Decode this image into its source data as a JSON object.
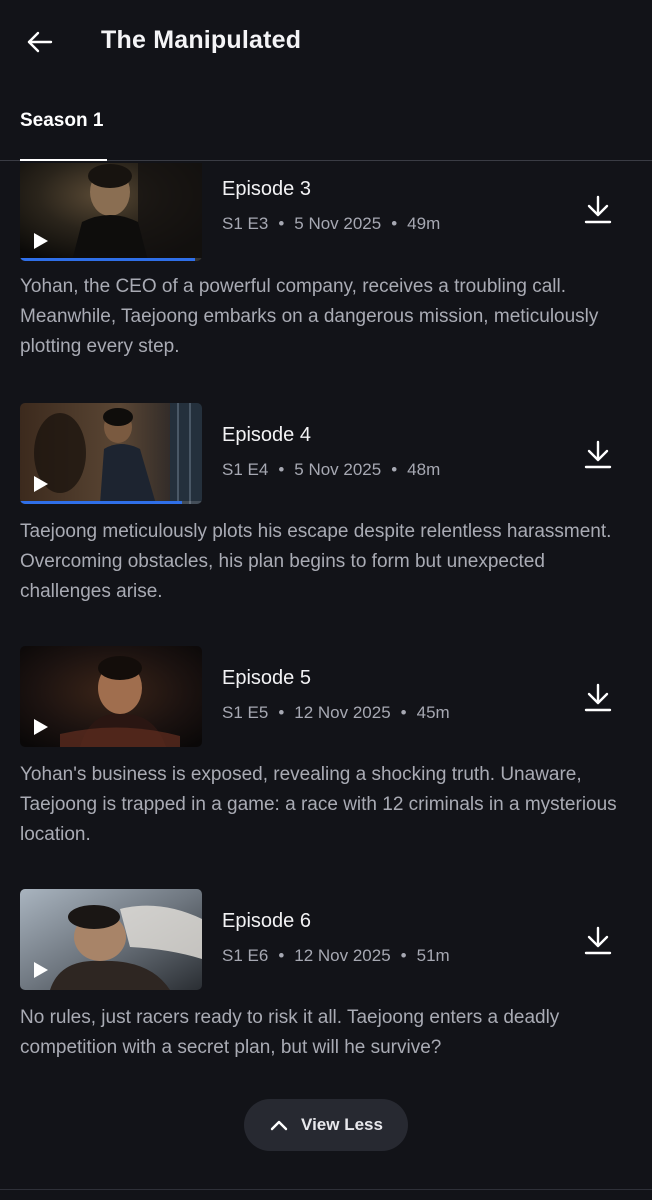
{
  "header": {
    "title": "The Manipulated"
  },
  "tabs": [
    {
      "label": "Season 1",
      "active": true
    }
  ],
  "episodes": [
    {
      "title": "Episode 3",
      "code": "S1 E3",
      "date": "5 Nov 2025",
      "duration": "49m",
      "description": "Yohan, the CEO of a powerful company, receives a troubling call. Meanwhile, Taejoong embarks on a dangerous mission, meticulously plotting every step.",
      "watch_progress": 0.96,
      "icons": {
        "play": "play-icon",
        "download": "download-icon"
      }
    },
    {
      "title": "Episode 4",
      "code": "S1 E4",
      "date": "5 Nov 2025",
      "duration": "48m",
      "description": "Taejoong meticulously plots his escape despite relentless harassment. Overcoming obstacles, his plan begins to form but unexpected challenges arise.",
      "watch_progress": 0.89,
      "icons": {
        "play": "play-icon",
        "download": "download-icon"
      }
    },
    {
      "title": "Episode 5",
      "code": "S1 E5",
      "date": "12 Nov 2025",
      "duration": "45m",
      "description": "Yohan's business is exposed, revealing a shocking truth. Unaware, Taejoong is trapped in a game: a race with 12 criminals in a mysterious location.",
      "watch_progress": 0,
      "icons": {
        "play": "play-icon",
        "download": "download-icon"
      }
    },
    {
      "title": "Episode 6",
      "code": "S1 E6",
      "date": "12 Nov 2025",
      "duration": "51m",
      "description": "No rules, just racers ready to risk it all. Taejoong enters a deadly competition with a secret plan, but will he survive?",
      "watch_progress": 0,
      "icons": {
        "play": "play-icon",
        "download": "download-icon"
      }
    }
  ],
  "view_less": {
    "label": "View Less",
    "icon": "chevron-up-icon"
  },
  "colors": {
    "background": "#121318",
    "progress": "#2f6fe8",
    "text_secondary": "#a9abb4",
    "pill_background": "#272931"
  }
}
